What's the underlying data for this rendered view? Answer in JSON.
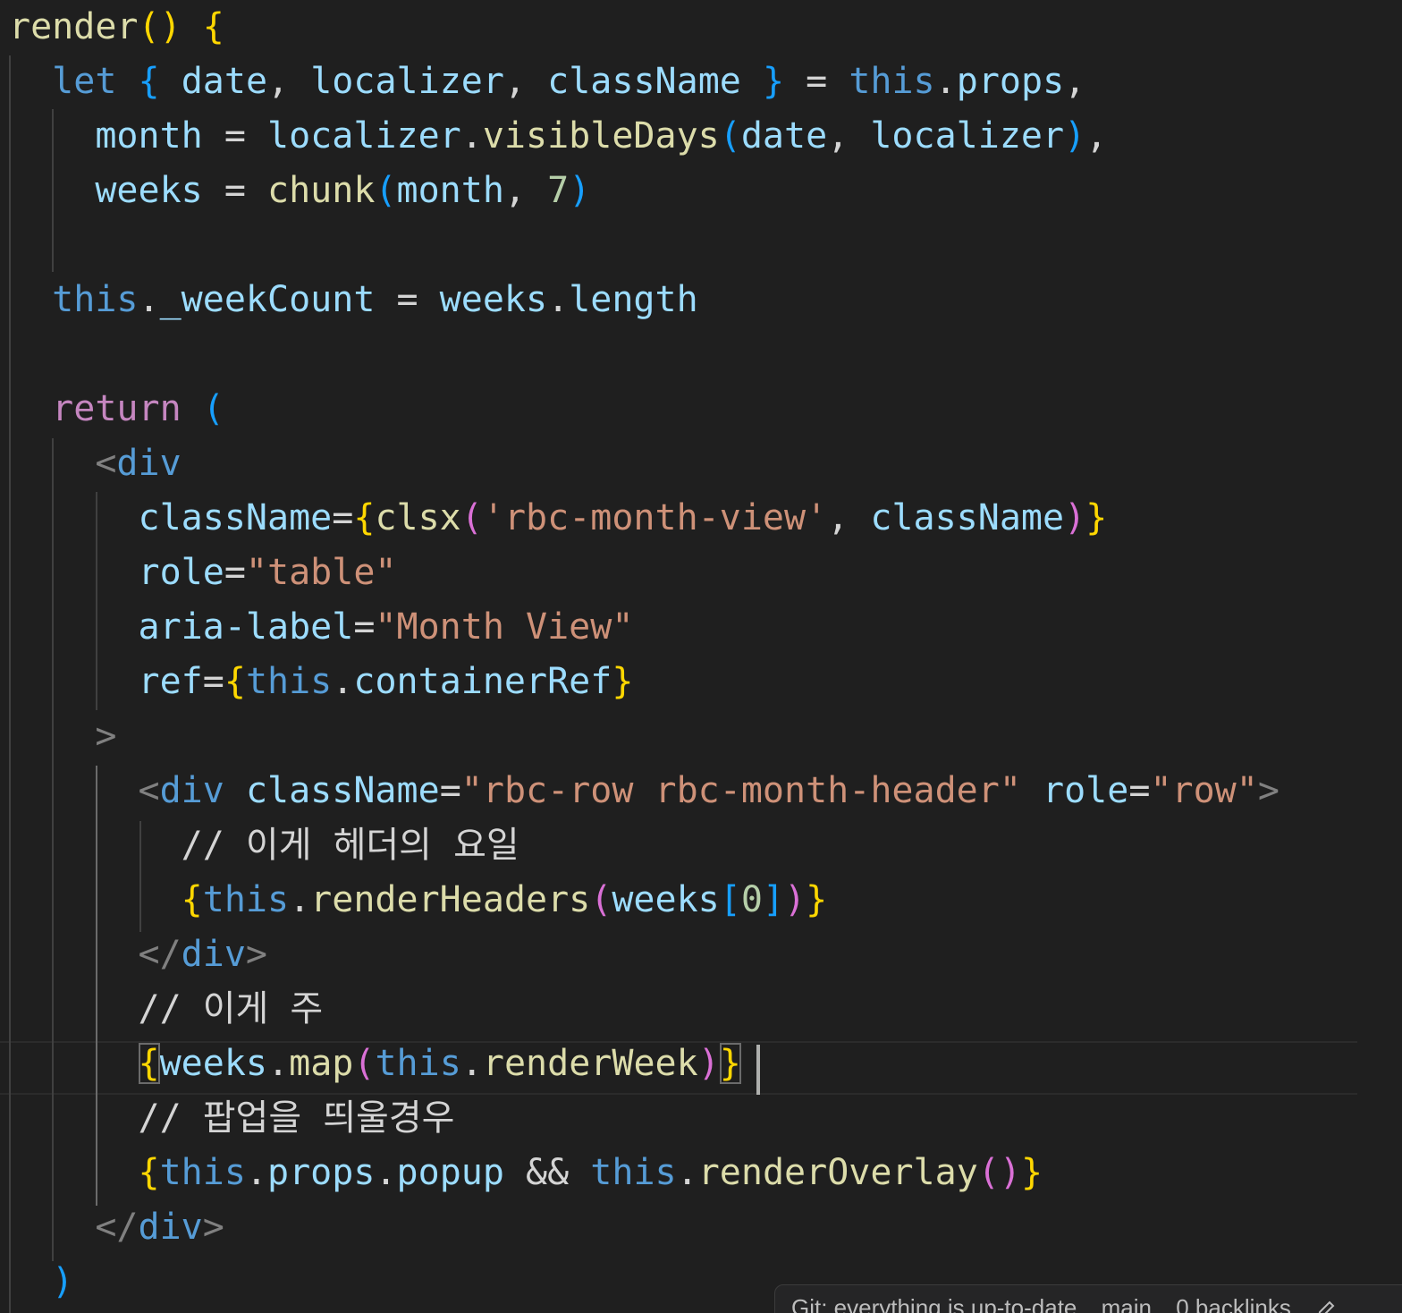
{
  "editor": {
    "language": "jsx",
    "theme": "dark",
    "lines": [
      "render() {",
      "  let { date, localizer, className } = this.props,",
      "    month = localizer.visibleDays(date, localizer),",
      "    weeks = chunk(month, 7)",
      "",
      "  this._weekCount = weeks.length",
      "",
      "  return (",
      "    <div",
      "      className={clsx('rbc-month-view', className)}",
      "      role=\"table\"",
      "      aria-label=\"Month View\"",
      "      ref={this.containerRef}",
      "    >",
      "      <div className=\"rbc-row rbc-month-header\" role=\"row\">",
      "        // 이게 헤더의 요일",
      "        {this.renderHeaders(weeks[0])}",
      "      </div>",
      "      // 이게 주",
      "      {weeks.map(this.renderWeek)}",
      "      // 팝업을 띄울경우",
      "      {this.props.popup && this.renderOverlay()}",
      "    </div>",
      "  )"
    ],
    "cursor_line": 20
  },
  "status": {
    "git": "Git: everything is up-to-date",
    "branch": "main",
    "backlinks": "0 backlinks",
    "edit_icon": "pencil-icon"
  }
}
